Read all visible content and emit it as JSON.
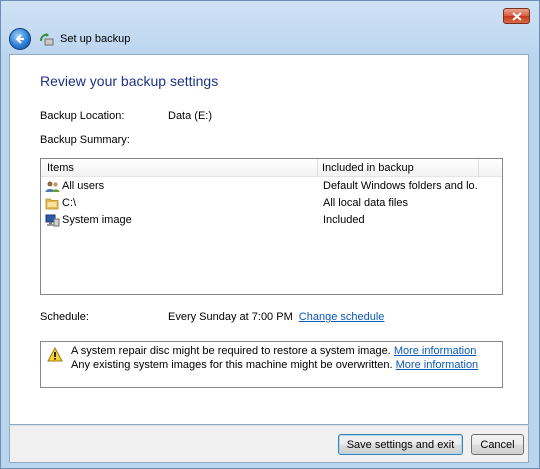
{
  "window": {
    "title": "Set up backup"
  },
  "heading": "Review your backup settings",
  "location": {
    "label": "Backup Location:",
    "value": "Data (E:)"
  },
  "summary": {
    "label": "Backup Summary:",
    "columns": [
      "Items",
      "Included in backup"
    ],
    "rows": [
      {
        "icon": "users-icon",
        "name": "All users",
        "included": "Default Windows folders and lo..."
      },
      {
        "icon": "folder-icon",
        "name": "C:\\",
        "included": "All local data files"
      },
      {
        "icon": "system-image-icon",
        "name": "System image",
        "included": "Included"
      }
    ]
  },
  "schedule": {
    "label": "Schedule:",
    "value": "Every Sunday at 7:00 PM",
    "change_link": "Change schedule"
  },
  "warning": {
    "line1": "A system repair disc might be required to restore a system image.",
    "line1_link": "More information",
    "line2": "Any existing system images for this machine might be overwritten.",
    "line2_link": "More information"
  },
  "buttons": {
    "save": "Save settings and exit",
    "cancel": "Cancel"
  },
  "colors": {
    "heading": "#1e3287",
    "link": "#0b58b5"
  }
}
